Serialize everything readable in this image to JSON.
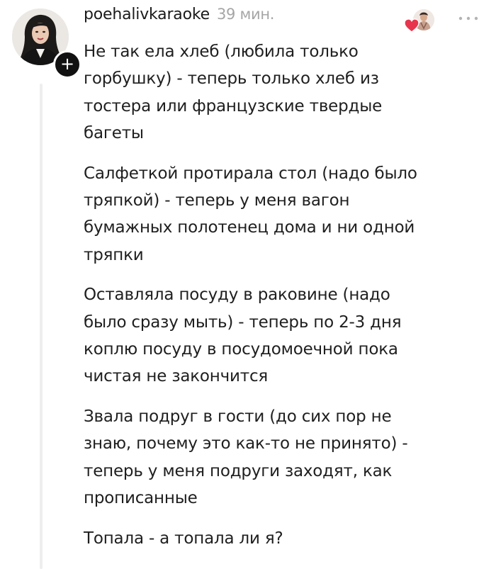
{
  "comment": {
    "username": "poehalivkaraoke",
    "timestamp": "39 мин.",
    "follow_label": "+",
    "more_label": "...",
    "paragraphs": [
      "Не так ела хлеб (любила только\nгорбушку) - теперь только хлеб из\nтостера или французские твердые\nбагеты",
      "Салфеткой протирала стол (надо было\nтряпкой) - теперь у меня вагон\nбумажных полотенец дома и ни одной\nтряпки",
      "Оставляла посуду в раковине (надо\nбыло сразу мыть) - теперь по 2-3 дня\nкоплю посуду в посудомоечной пока\nчистая не закончится",
      "Звала подруг в гости (до сих пор не\nзнаю, почему это как-то не принято) -\nтеперь у меня подруги заходят, как\nпрописанные",
      "Топала - а топала ли я?"
    ]
  },
  "icons": {
    "avatar": "user-avatar-photo",
    "follow": "plus-icon",
    "author_like": "heart-icon",
    "more": "more-dots-icon"
  },
  "colors": {
    "heart": "#e8354e",
    "timestamp": "#a6a6a6",
    "follow_bg": "#111111",
    "thread_line": "#eeeeee"
  }
}
